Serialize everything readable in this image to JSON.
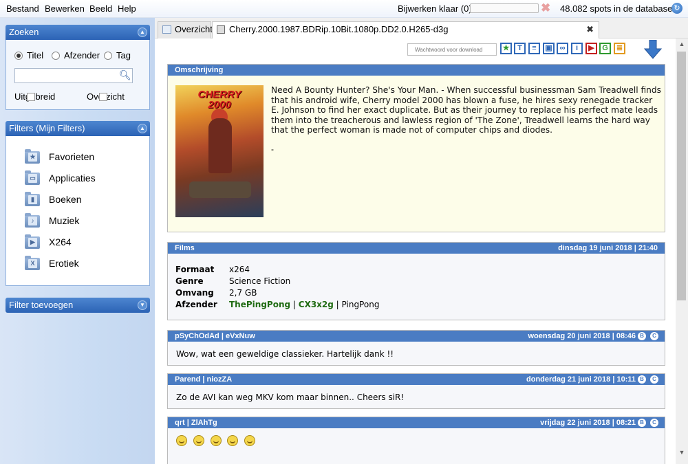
{
  "menu": {
    "bestand": "Bestand",
    "bewerken": "Bewerken",
    "beeld": "Beeld",
    "help": "Help"
  },
  "status": {
    "update_text": "Bijwerken klaar (0)",
    "progress": 0,
    "spots_text": "48.082 spots in de database"
  },
  "sidebar": {
    "search_panel": {
      "title": "Zoeken",
      "options": [
        "Titel",
        "Afzender",
        "Tag"
      ],
      "selected": "Titel",
      "input_value": "",
      "checkbox_extended": "Uitgebreid",
      "checkbox_overview": "Overzicht"
    },
    "filters_panel": {
      "title": "Filters (Mijn Filters)",
      "items": [
        {
          "label": "Favorieten",
          "icon": "favorites-folder-icon"
        },
        {
          "label": "Applicaties",
          "icon": "applications-folder-icon"
        },
        {
          "label": "Boeken",
          "icon": "books-folder-icon"
        },
        {
          "label": "Muziek",
          "icon": "music-folder-icon"
        },
        {
          "label": "X264",
          "icon": "video-folder-icon"
        },
        {
          "label": "Erotiek",
          "icon": "erotica-folder-icon"
        }
      ]
    },
    "add_filter_panel": {
      "title": "Filter toevoegen"
    }
  },
  "tabs": [
    {
      "label": "Overzicht"
    },
    {
      "label": "Cherry.2000.1987.BDRip.10Bit.1080p.DD2.0.H265-d3g",
      "close": "✖"
    }
  ],
  "toolbar": {
    "password_placeholder": "Wachtwoord voor download",
    "buttons": [
      "favorite-star-icon",
      "text-icon",
      "description-icon",
      "image-icon",
      "link-icon",
      "info-icon",
      "youtube-icon",
      "google-icon",
      "database-icon"
    ],
    "download_icon": "download-arrow-icon"
  },
  "colors": {
    "accent": "#4a7cc3",
    "desc_bg": "#fdfde9",
    "green_sender": "#1f6b12"
  },
  "description": {
    "header": "Omschrijving",
    "poster_title": "CHERRY 2000",
    "text": "Need A Bounty Hunter? She's Your Man. - When successful businessman Sam Treadwell finds that his android wife, Cherry model 2000 has blown a fuse, he hires sexy renegade tracker E. Johnson to find her exact duplicate. But as their journey to replace his perfect mate leads them into the treacherous and lawless region of 'The Zone', Treadwell learns the hard way that the perfect woman is made not of computer chips and diodes.",
    "trailing": "-"
  },
  "films": {
    "header": "Films",
    "date": "dinsdag 19 juni 2018 | 21:40",
    "format_label": "Formaat",
    "format_value": "x264",
    "genre_label": "Genre",
    "genre_value": "Science Fiction",
    "size_label": "Omvang",
    "size_value": "2,7 GB",
    "sender_label": "Afzender",
    "sender_name": "ThePingPong",
    "sender_id": "CX3x2g",
    "sender_alias": "PingPong"
  },
  "comments": [
    {
      "author": "pSyChOdAd | eVxNuw",
      "date": "woensdag 20 juni 2018 | 08:46",
      "text": "Wow, wat een geweldige classieker. Hartelijk dank !!"
    },
    {
      "author": "Parend | niozZA",
      "date": "donderdag 21 juni 2018 | 10:11",
      "text": "Zo de AVI kan weg MKV kom maar binnen.. Cheers siR!"
    },
    {
      "author": "qrt | ZlAhTg",
      "date": "vrijdag 22 juni 2018 | 08:21",
      "text": "",
      "emoji_count": 5
    }
  ]
}
